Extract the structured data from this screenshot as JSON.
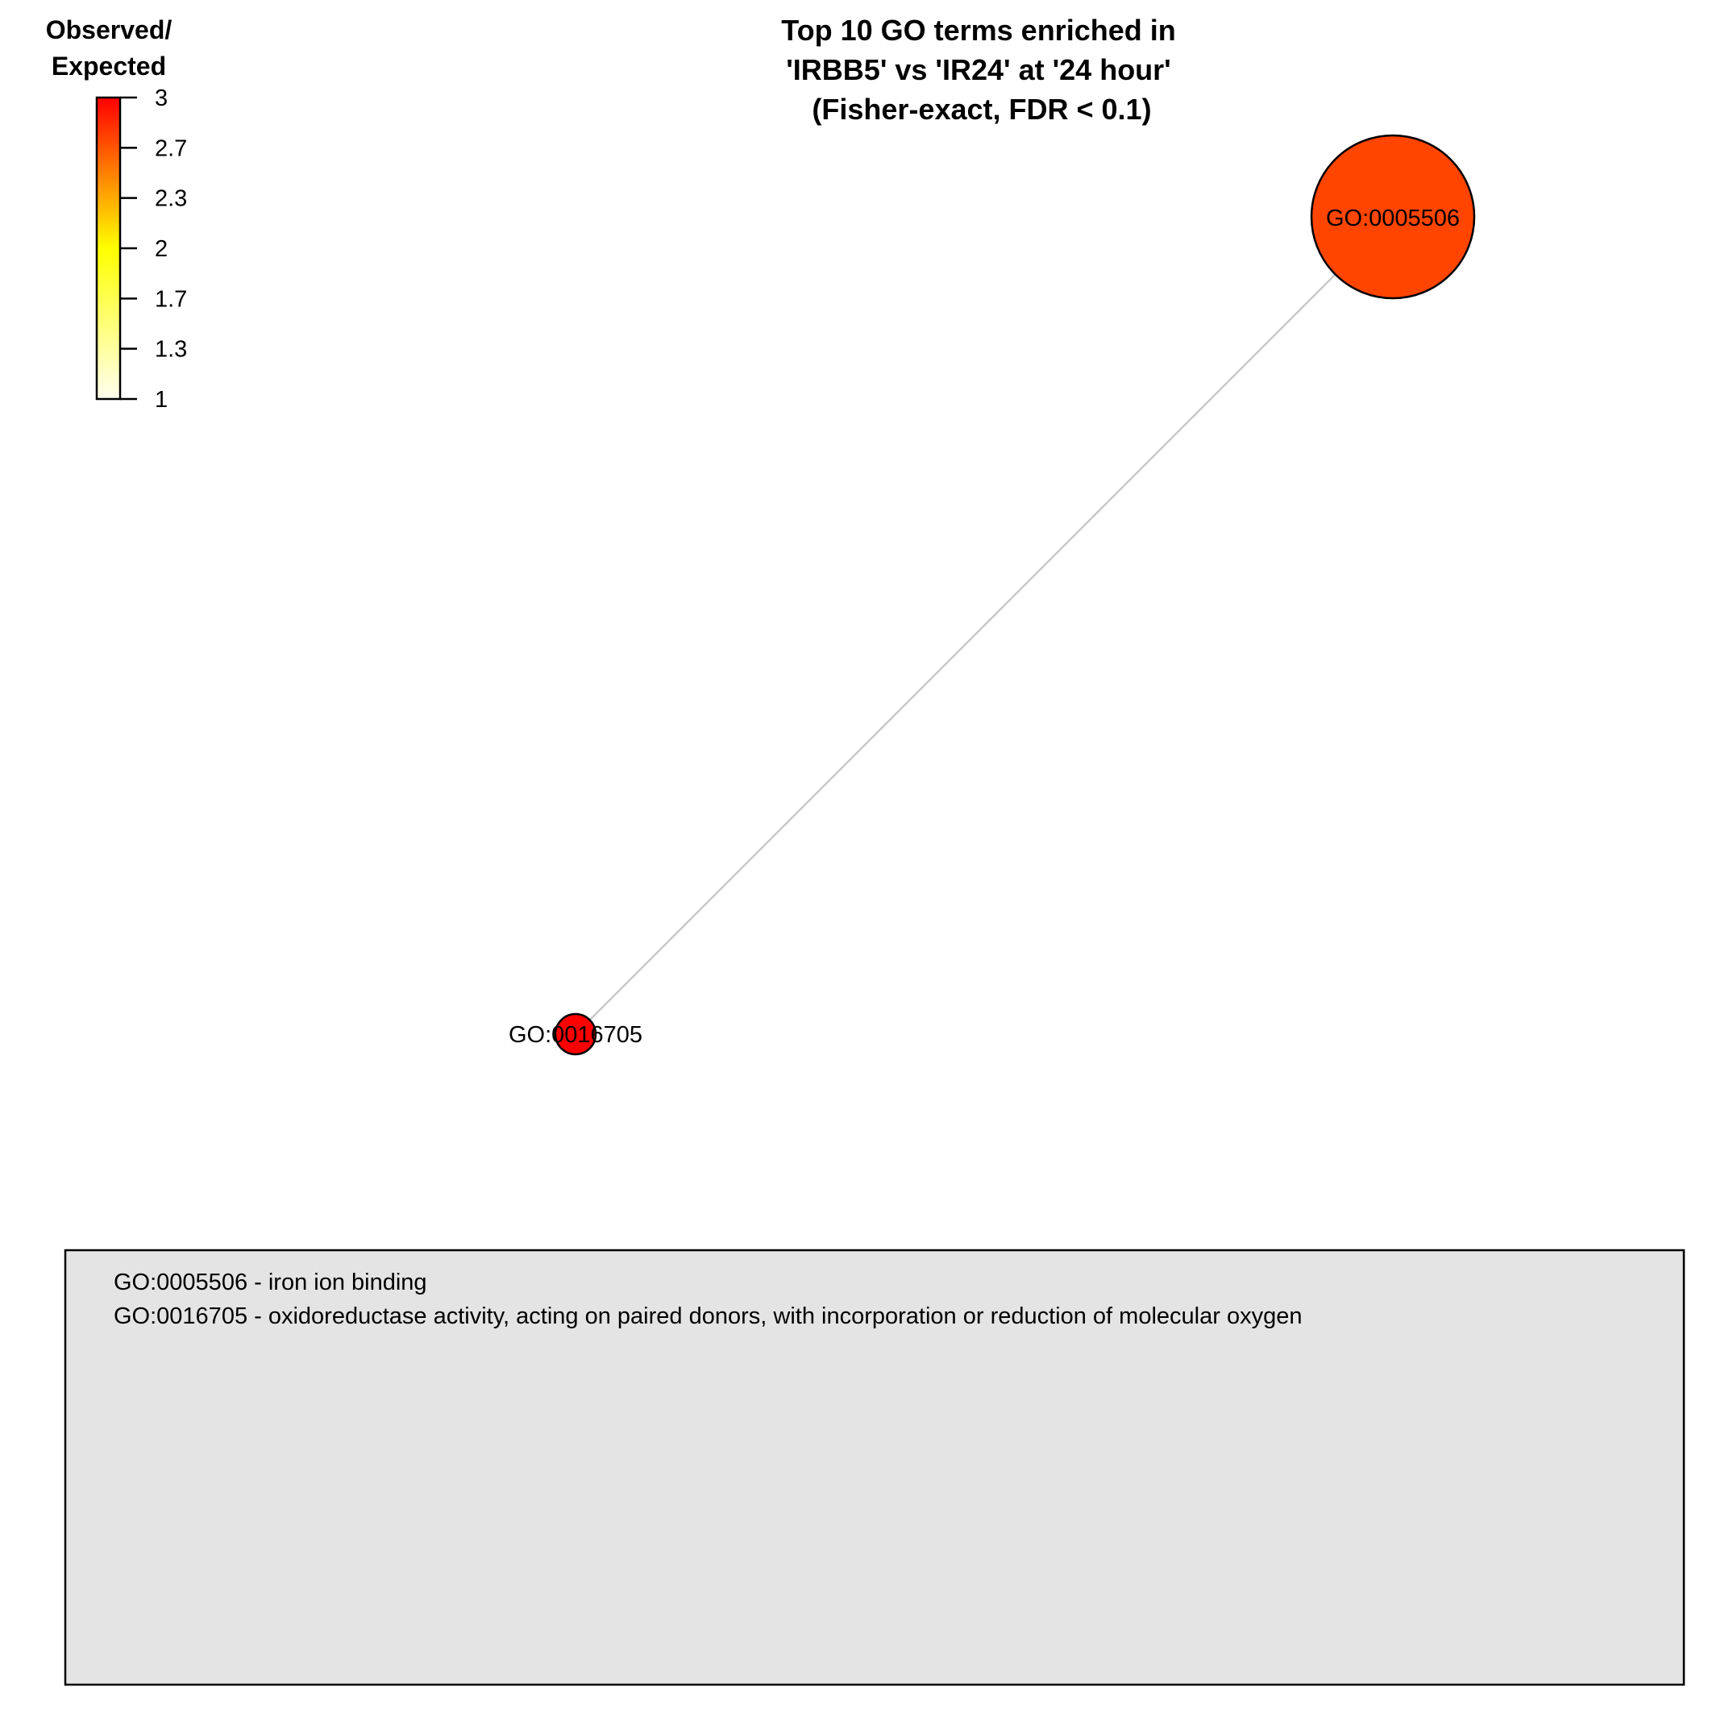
{
  "title": {
    "lines": [
      "Top 10 GO terms enriched in",
      "'IRBB5' vs 'IR24' at '24 hour'",
      "(Fisher-exact, FDR < 0.1)"
    ]
  },
  "color_legend": {
    "title_lines": [
      "Observed/",
      "Expected"
    ],
    "ticks": [
      "3",
      "2.7",
      "2.3",
      "2",
      "1.7",
      "1.3",
      "1"
    ],
    "range": [
      1,
      3
    ],
    "colors": {
      "low": "#fffff0",
      "mid": "#ffff00",
      "high": "#ff0000"
    }
  },
  "network": {
    "nodes": [
      {
        "id": "GO:0005506",
        "observed_expected": 2.85,
        "fill": "#ff4500"
      },
      {
        "id": "GO:0016705",
        "observed_expected": 3.0,
        "fill": "#ff0000"
      }
    ],
    "edges": [
      {
        "from": "GO:0005506",
        "to": "GO:0016705",
        "color": "#c8c8c8"
      }
    ]
  },
  "description_box": {
    "background": "#e4e4e4",
    "lines": [
      "GO:0005506 - iron ion binding",
      "GO:0016705 - oxidoreductase activity, acting on paired donors, with incorporation or reduction of molecular oxygen"
    ]
  }
}
